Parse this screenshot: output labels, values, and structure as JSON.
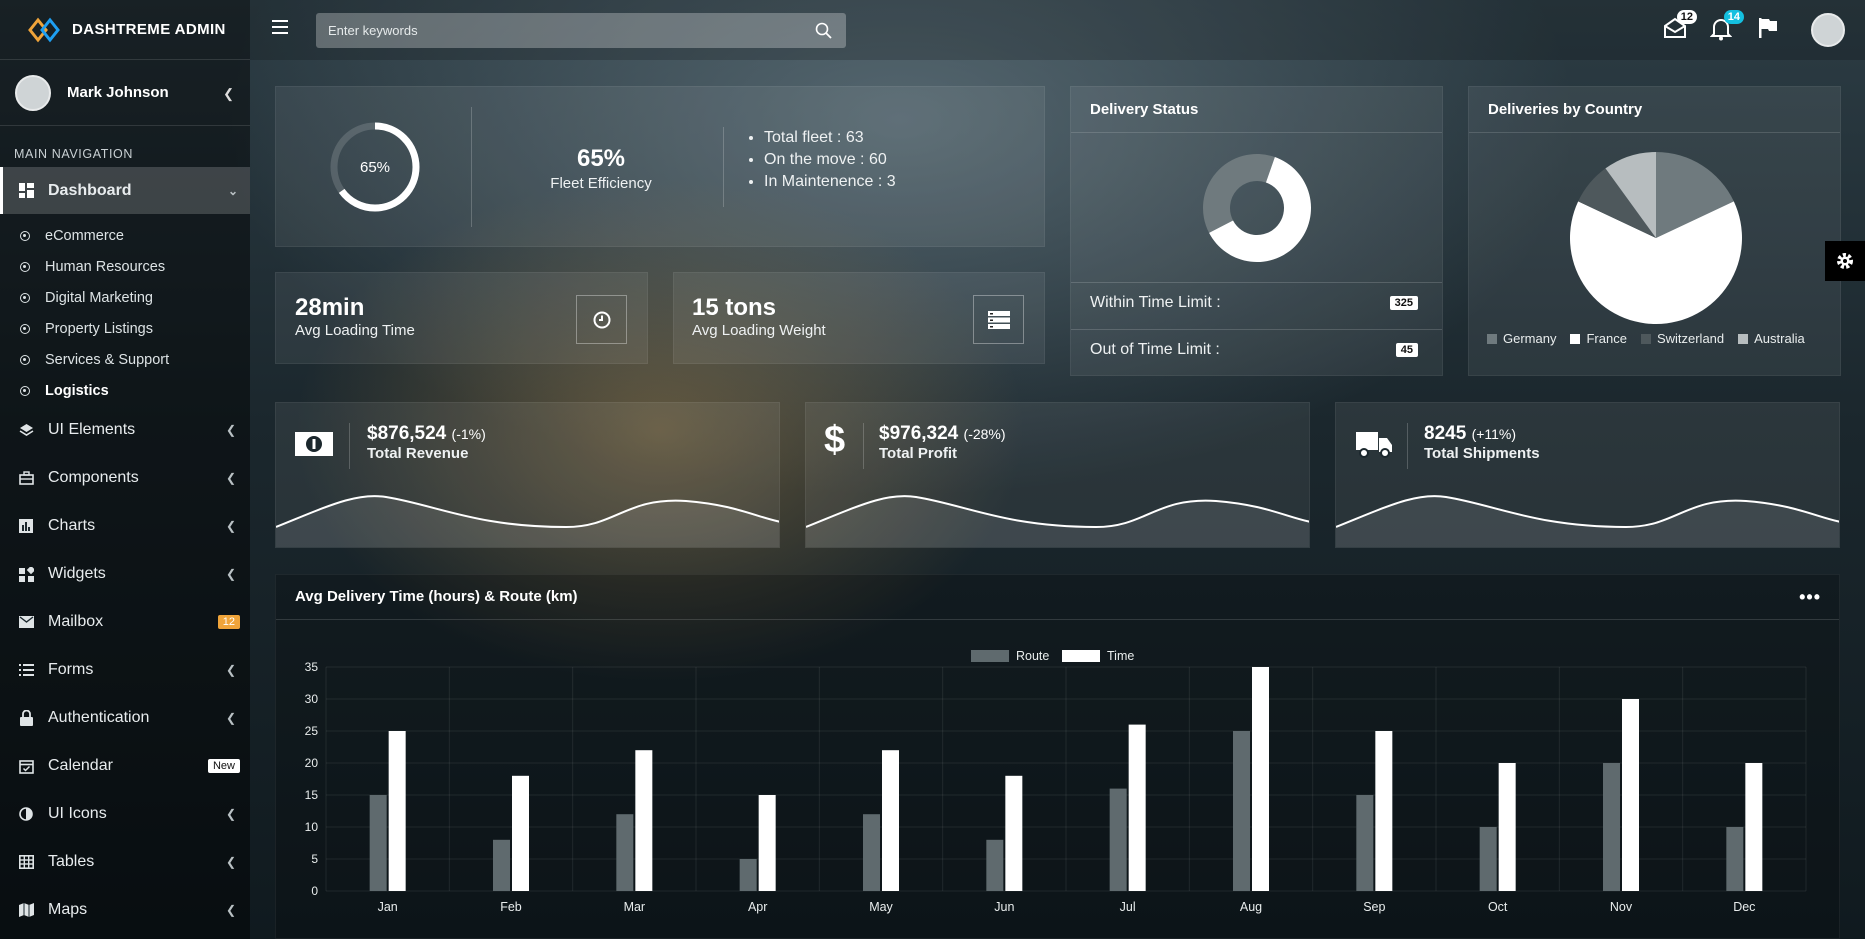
{
  "app": {
    "title": "DASHTREME ADMIN"
  },
  "user": {
    "name": "Mark Johnson"
  },
  "sidebar": {
    "header": "MAIN NAVIGATION",
    "dashboard": "Dashboard",
    "subs": [
      "eCommerce",
      "Human Resources",
      "Digital Marketing",
      "Property Listings",
      "Services & Support",
      "Logistics"
    ],
    "items": [
      {
        "label": "UI Elements",
        "icon": "layers-icon"
      },
      {
        "label": "Components",
        "icon": "briefcase-icon"
      },
      {
        "label": "Charts",
        "icon": "bar-chart-icon"
      },
      {
        "label": "Widgets",
        "icon": "widgets-icon"
      },
      {
        "label": "Mailbox",
        "icon": "mail-icon",
        "badge": "12"
      },
      {
        "label": "Forms",
        "icon": "list-icon"
      },
      {
        "label": "Authentication",
        "icon": "lock-icon"
      },
      {
        "label": "Calendar",
        "icon": "calendar-icon",
        "badge": "New"
      },
      {
        "label": "UI Icons",
        "icon": "contrast-icon"
      },
      {
        "label": "Tables",
        "icon": "grid-icon"
      },
      {
        "label": "Maps",
        "icon": "map-icon"
      }
    ]
  },
  "topbar": {
    "search_placeholder": "Enter keywords",
    "mail_count": "12",
    "notif_count": "14"
  },
  "fleet": {
    "gauge": "65%",
    "gauge_fraction": 0.65,
    "value": "65%",
    "label": "Fleet Efficiency",
    "stats": [
      "Total fleet : 63",
      "On the move : 60",
      "In Maintenence : 3"
    ]
  },
  "loading_time": {
    "value": "28min",
    "label": "Avg Loading Time"
  },
  "loading_weight": {
    "value": "15 tons",
    "label": "Avg Loading Weight"
  },
  "delivery_status": {
    "title": "Delivery Status",
    "within_label": "Within Time Limit :",
    "within_value": "325",
    "out_label": "Out of Time Limit :",
    "out_value": "45"
  },
  "country": {
    "title": "Deliveries by Country",
    "legend": [
      "Germany",
      "France",
      "Switzerland",
      "Australia"
    ]
  },
  "revenue": {
    "value": "$876,524",
    "change": "(-1%)",
    "label": "Total Revenue"
  },
  "profit": {
    "value": "$976,324",
    "change": "(-28%)",
    "label": "Total Profit"
  },
  "shipments": {
    "value": "8245",
    "change": "(+11%)",
    "label": "Total Shipments"
  },
  "colors": {
    "route": "#5f6a6e",
    "time": "#ffffff"
  },
  "chart_data": [
    {
      "type": "pie",
      "title": "Delivery Status",
      "donut": true,
      "categories": [
        "Within Time Limit",
        "Out of Time Limit"
      ],
      "values": [
        325,
        45
      ]
    },
    {
      "type": "pie",
      "title": "Deliveries by Country",
      "categories": [
        "Germany",
        "France",
        "Switzerland",
        "Australia"
      ],
      "values": [
        18,
        64,
        8,
        10
      ]
    },
    {
      "type": "bar",
      "title": "Avg Delivery Time (hours) & Route (km)",
      "categories": [
        "Jan",
        "Feb",
        "Mar",
        "Apr",
        "May",
        "Jun",
        "Jul",
        "Aug",
        "Sep",
        "Oct",
        "Nov",
        "Dec"
      ],
      "series": [
        {
          "name": "Route",
          "values": [
            15,
            8,
            12,
            5,
            12,
            8,
            16,
            25,
            15,
            10,
            20,
            10
          ]
        },
        {
          "name": "Time",
          "values": [
            25,
            18,
            22,
            15,
            22,
            18,
            26,
            35,
            25,
            20,
            30,
            20
          ]
        }
      ],
      "yticks": [
        "0",
        "5",
        "10",
        "15",
        "20",
        "25",
        "30",
        "35"
      ],
      "ylim": [
        0,
        35
      ],
      "legend": "top",
      "grid": true
    }
  ]
}
